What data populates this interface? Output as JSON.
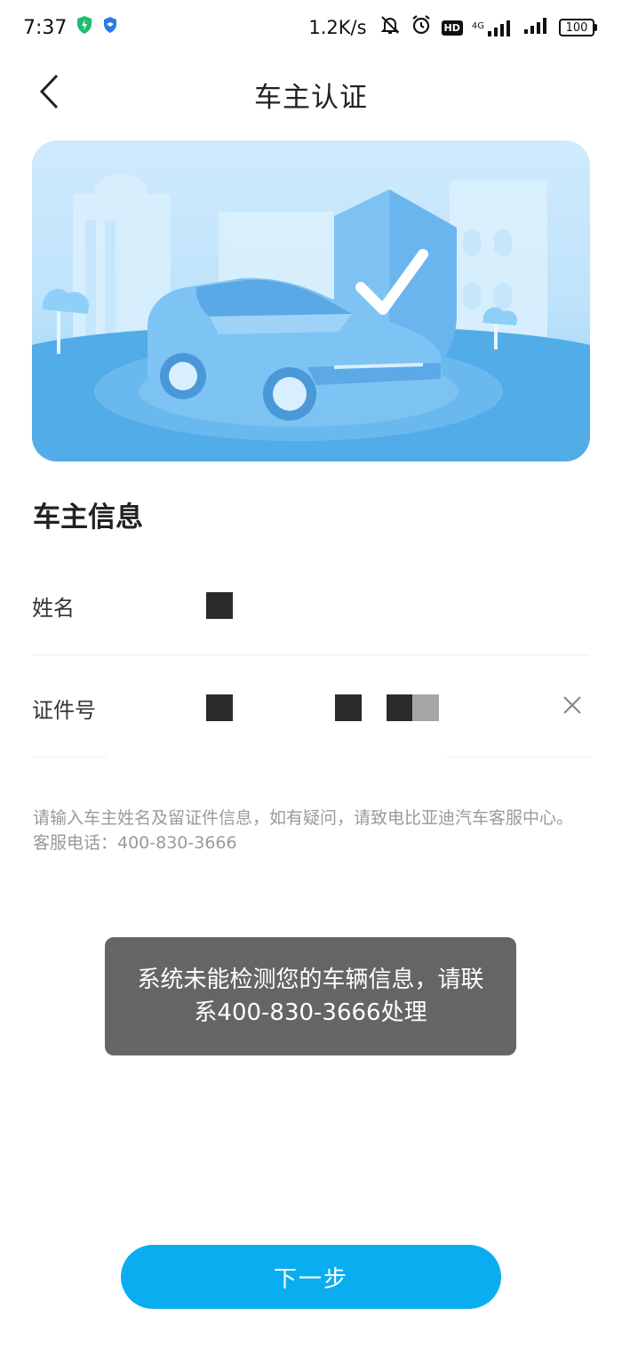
{
  "status_bar": {
    "time": "7:37",
    "network_speed": "1.2K/s",
    "hd_label": "HD",
    "network_type": "4G",
    "battery": "100"
  },
  "header": {
    "title": "车主认证",
    "back_icon": "chevron-left-icon"
  },
  "banner": {
    "illustration": "car-with-shield-check"
  },
  "owner_info": {
    "section_title": "车主信息",
    "name_label": "姓名",
    "id_label": "证件号",
    "clear_icon": "close-icon"
  },
  "hint": {
    "line1": "请输入车主姓名及留证件信息，如有疑问，请致电比亚迪汽车客服中心。",
    "line2": "客服电话：400-830-3666"
  },
  "toast": {
    "message": "系统未能检测您的车辆信息，请联系400-830-3666处理"
  },
  "next_button": {
    "label": "下一步"
  },
  "colors": {
    "accent": "#0aaef0",
    "banner_light": "#cfeafc",
    "banner_dark": "#4aa9e6"
  }
}
